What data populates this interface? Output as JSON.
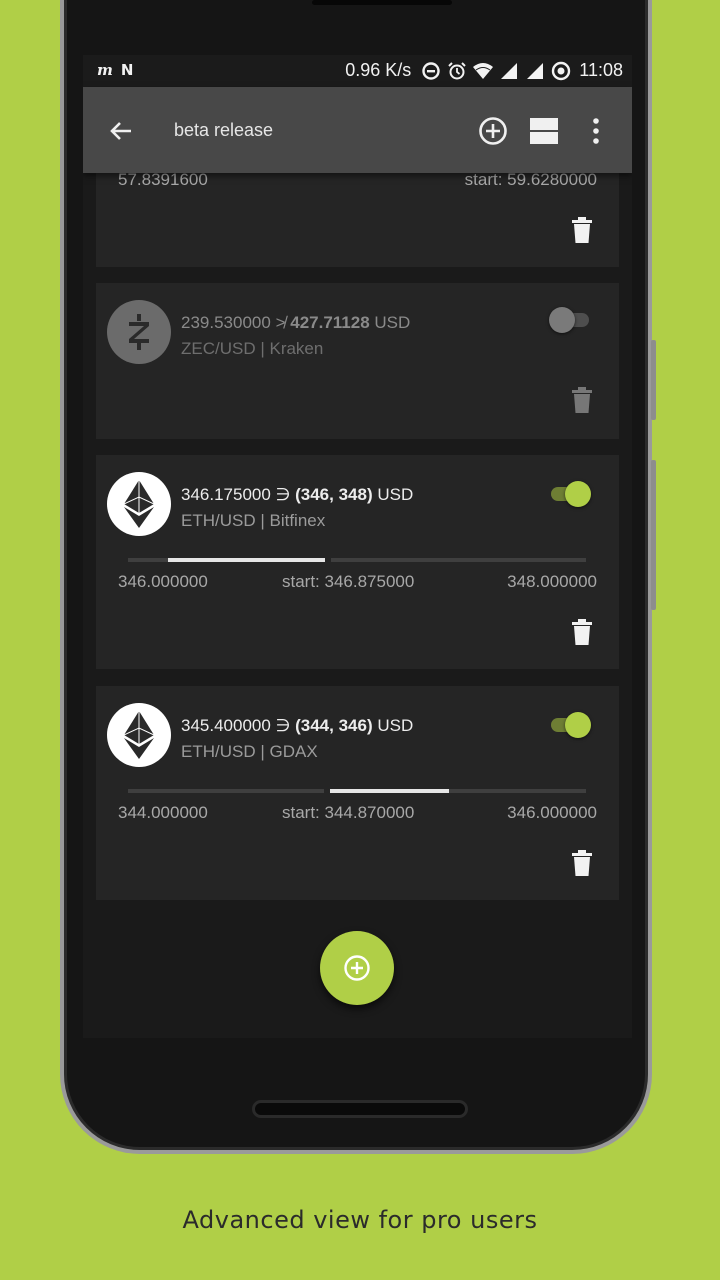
{
  "status_bar": {
    "left_icons": [
      "notification-m-icon",
      "notification-n-icon"
    ],
    "speed": "0.96 K/s",
    "time": "11:08",
    "right_icons": [
      "data-saver-icon",
      "alarm-icon",
      "wifi-icon",
      "signal-icon",
      "signal-icon-2",
      "sync-icon"
    ]
  },
  "app_bar": {
    "title": "beta release",
    "icons": [
      "back-arrow-icon",
      "add-circle-icon",
      "view-stream-icon",
      "more-vert-icon"
    ]
  },
  "cards": [
    {
      "partial": true,
      "left_label": "57.8391600",
      "start_label": "start: 59.6280000"
    },
    {
      "coin": "zcash",
      "price": "239.530000",
      "operator": "≯",
      "target": "427.71128",
      "currency": "USD",
      "pair": "ZEC/USD | Kraken",
      "enabled": false
    },
    {
      "coin": "ethereum",
      "price": "346.175000",
      "operator": "∋",
      "target": "(346, 348)",
      "currency": "USD",
      "pair": "ETH/USD | Bitfinex",
      "enabled": true,
      "range_fill": 0.0875,
      "min_label": "346.000000",
      "start_label": "start: 346.875000",
      "max_label": "348.000000"
    },
    {
      "coin": "ethereum",
      "price": "345.400000",
      "operator": "∋",
      "target": "(344, 346)",
      "currency": "USD",
      "pair": "ETH/USD | GDAX",
      "enabled": true,
      "range_fill": 0.7,
      "min_label": "344.000000",
      "start_label": "start: 344.870000",
      "max_label": "346.000000"
    }
  ],
  "fab": {
    "icon": "add-circle-icon"
  },
  "caption": "Advanced view for pro users",
  "colors": {
    "accent": "#b0cf47",
    "background": "#1a1a1a",
    "card": "#252525",
    "appbar": "#484848"
  }
}
